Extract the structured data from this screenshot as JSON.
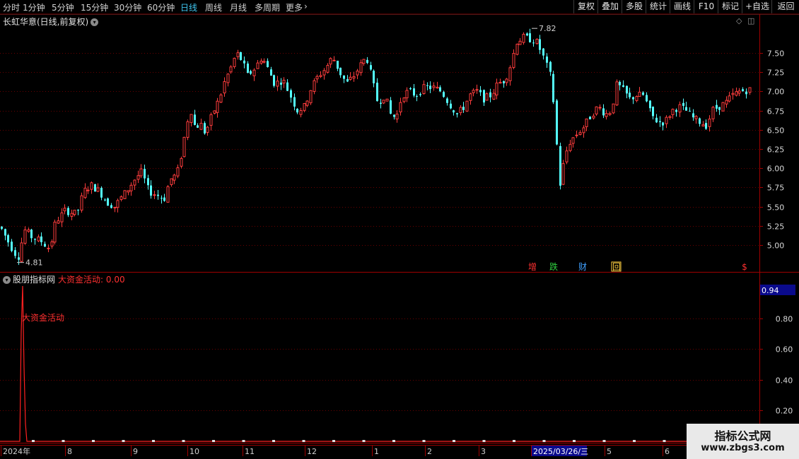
{
  "toolbar": {
    "periods": [
      "分时",
      "1分钟",
      "5分钟",
      "15分钟",
      "30分钟",
      "60分钟",
      "日线",
      "周线",
      "月线",
      "多周期",
      "更多"
    ],
    "active_period": "日线",
    "more_arrow": "›",
    "right_buttons": [
      "复权",
      "叠加",
      "多股",
      "统计",
      "画线",
      "F10",
      "标记",
      "+自选",
      "返回"
    ]
  },
  "main_chart": {
    "title": "长虹华意(日线,前复权)",
    "high_label": "7.82",
    "low_label": "4.81",
    "price_ticks": [
      "7.50",
      "7.25",
      "7.00",
      "6.75",
      "6.50",
      "6.25",
      "6.00",
      "5.75",
      "5.50",
      "5.25",
      "5.00"
    ],
    "markers": [
      {
        "text": "增",
        "color": "#ff3030"
      },
      {
        "text": "跌",
        "color": "#30d040"
      },
      {
        "text": "财",
        "color": "#40a0ff"
      },
      {
        "text": "回",
        "color": "#ffd040"
      },
      {
        "text": "$",
        "color": "#ff3030"
      }
    ],
    "up_color": "#ff3d3d",
    "down_color": "#54ffff"
  },
  "indicator": {
    "source": "股朋指标网",
    "name": "大资金活动",
    "value": "0.00",
    "value_full": "大资金活动: 0.00",
    "peak_label": "大资金活动",
    "current_value_box": "0.94",
    "ticks": [
      "0.80",
      "0.60",
      "0.40",
      "0.20"
    ]
  },
  "date_axis": {
    "labels": [
      "2024年",
      "8",
      "9",
      "10",
      "11",
      "12",
      "1",
      "2",
      "3",
      "2025/03/26/三",
      "5",
      "6"
    ],
    "highlight_label": "2025/03/26/三"
  },
  "watermark": {
    "title": "指标公式网",
    "url": "www.zbgs3.com"
  }
}
